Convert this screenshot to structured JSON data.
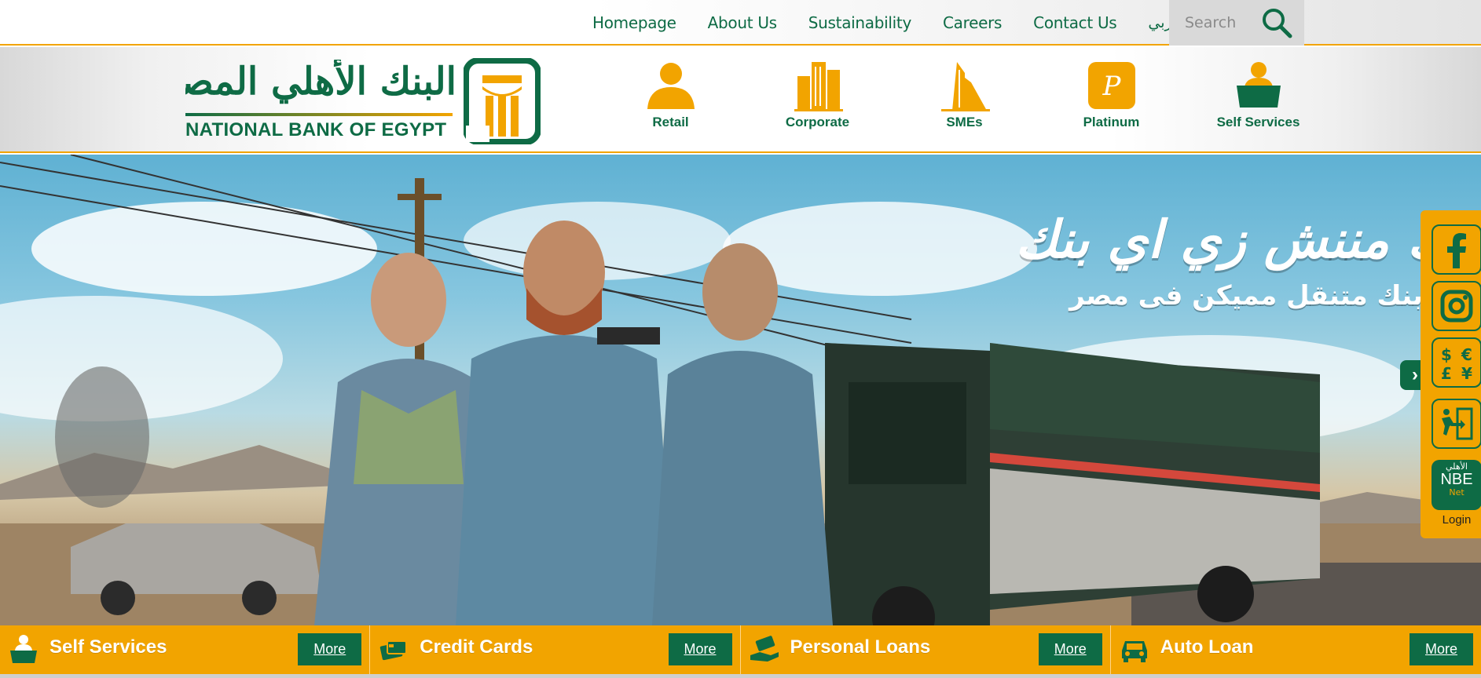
{
  "top_nav": {
    "links": [
      "Homepage",
      "About Us",
      "Sustainability",
      "Careers",
      "Contact Us"
    ],
    "language_link": "عربي",
    "search_placeholder": "Search"
  },
  "logo": {
    "arabic_name": "البنك الأهلي المصري",
    "english_name": "NATIONAL BANK OF EGYPT"
  },
  "segments": [
    {
      "label": "Retail",
      "icon": "person-icon"
    },
    {
      "label": "Corporate",
      "icon": "buildings-icon"
    },
    {
      "label": "SMEs",
      "icon": "building-icon"
    },
    {
      "label": "Platinum",
      "icon": "platinum-p-icon"
    },
    {
      "label": "Self Services",
      "icon": "person-laptop-icon"
    }
  ],
  "hero": {
    "title": "بنك مننش زي اي بنك",
    "subtitle": "أول بنك متنقل مميكن فى مصر",
    "next_arrow": "›"
  },
  "sidebar": {
    "buttons": [
      {
        "icon": "facebook-icon"
      },
      {
        "icon": "instagram-icon"
      },
      {
        "icon": "currency-icon"
      },
      {
        "icon": "door-exit-icon"
      }
    ],
    "nbe_net": {
      "top": "الأهلي",
      "main": "NBE",
      "sub": "Net"
    },
    "login_label": "Login"
  },
  "quick_links": [
    {
      "title": "Self Services",
      "more": "More",
      "icon": "person-laptop-icon"
    },
    {
      "title": "Credit Cards",
      "more": "More",
      "icon": "card-icon"
    },
    {
      "title": "Personal Loans",
      "more": "More",
      "icon": "hand-money-icon"
    },
    {
      "title": "Auto Loan",
      "more": "More",
      "icon": "car-icon"
    }
  ],
  "colors": {
    "brand_green": "#0e6b45",
    "brand_orange": "#f2a400"
  }
}
